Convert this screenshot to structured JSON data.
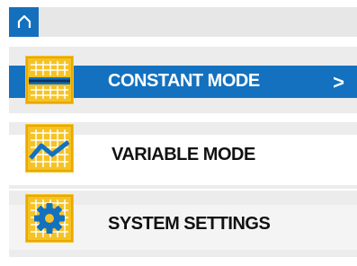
{
  "colors": {
    "accent": "#1371bf",
    "tile": "#f6c326",
    "topbar": "#e7e7e7"
  },
  "header": {
    "home_icon": "home-icon"
  },
  "menu": {
    "items": [
      {
        "label": "CONSTANT MODE",
        "icon": "constant-line-grid-icon",
        "selected": true,
        "chevron": ">"
      },
      {
        "label": "VARIABLE MODE",
        "icon": "variable-line-grid-icon",
        "selected": false
      },
      {
        "label": "SYSTEM SETTINGS",
        "icon": "gear-grid-icon",
        "selected": false
      }
    ]
  }
}
